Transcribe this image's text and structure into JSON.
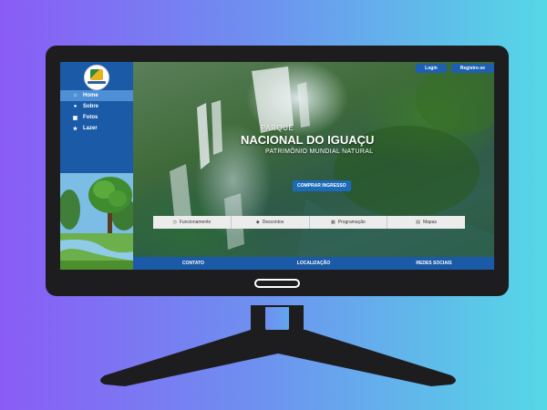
{
  "header": {
    "login_label": "Login",
    "register_label": "Registre-se"
  },
  "sidebar": {
    "items": [
      {
        "label": "Home",
        "icon": "home-icon",
        "active": true
      },
      {
        "label": "Sobre",
        "icon": "info-icon"
      },
      {
        "label": "Fotos",
        "icon": "image-icon"
      },
      {
        "label": "Lazer",
        "icon": "star-icon"
      }
    ]
  },
  "hero": {
    "line1": "PARQUE",
    "line2": "NACIONAL DO IGUAÇU",
    "line3": "PATRIMÔNIO MUNDIAL NATURAL",
    "cta_label": "COMPRAR INGRESSO"
  },
  "quicklinks": [
    {
      "label": "Funcionamento",
      "icon": "clock-icon"
    },
    {
      "label": "Descontos",
      "icon": "tag-icon"
    },
    {
      "label": "Programação",
      "icon": "calendar-icon"
    },
    {
      "label": "Mapas",
      "icon": "map-icon"
    }
  ],
  "footer": {
    "items": [
      "CONTATO",
      "LOCALIZAÇÃO",
      "REDES SOCIAIS"
    ]
  },
  "colors": {
    "brand_blue": "#1a5aa6",
    "active_nav": "#4f8fd6",
    "button_blue": "#1d6bb8"
  }
}
